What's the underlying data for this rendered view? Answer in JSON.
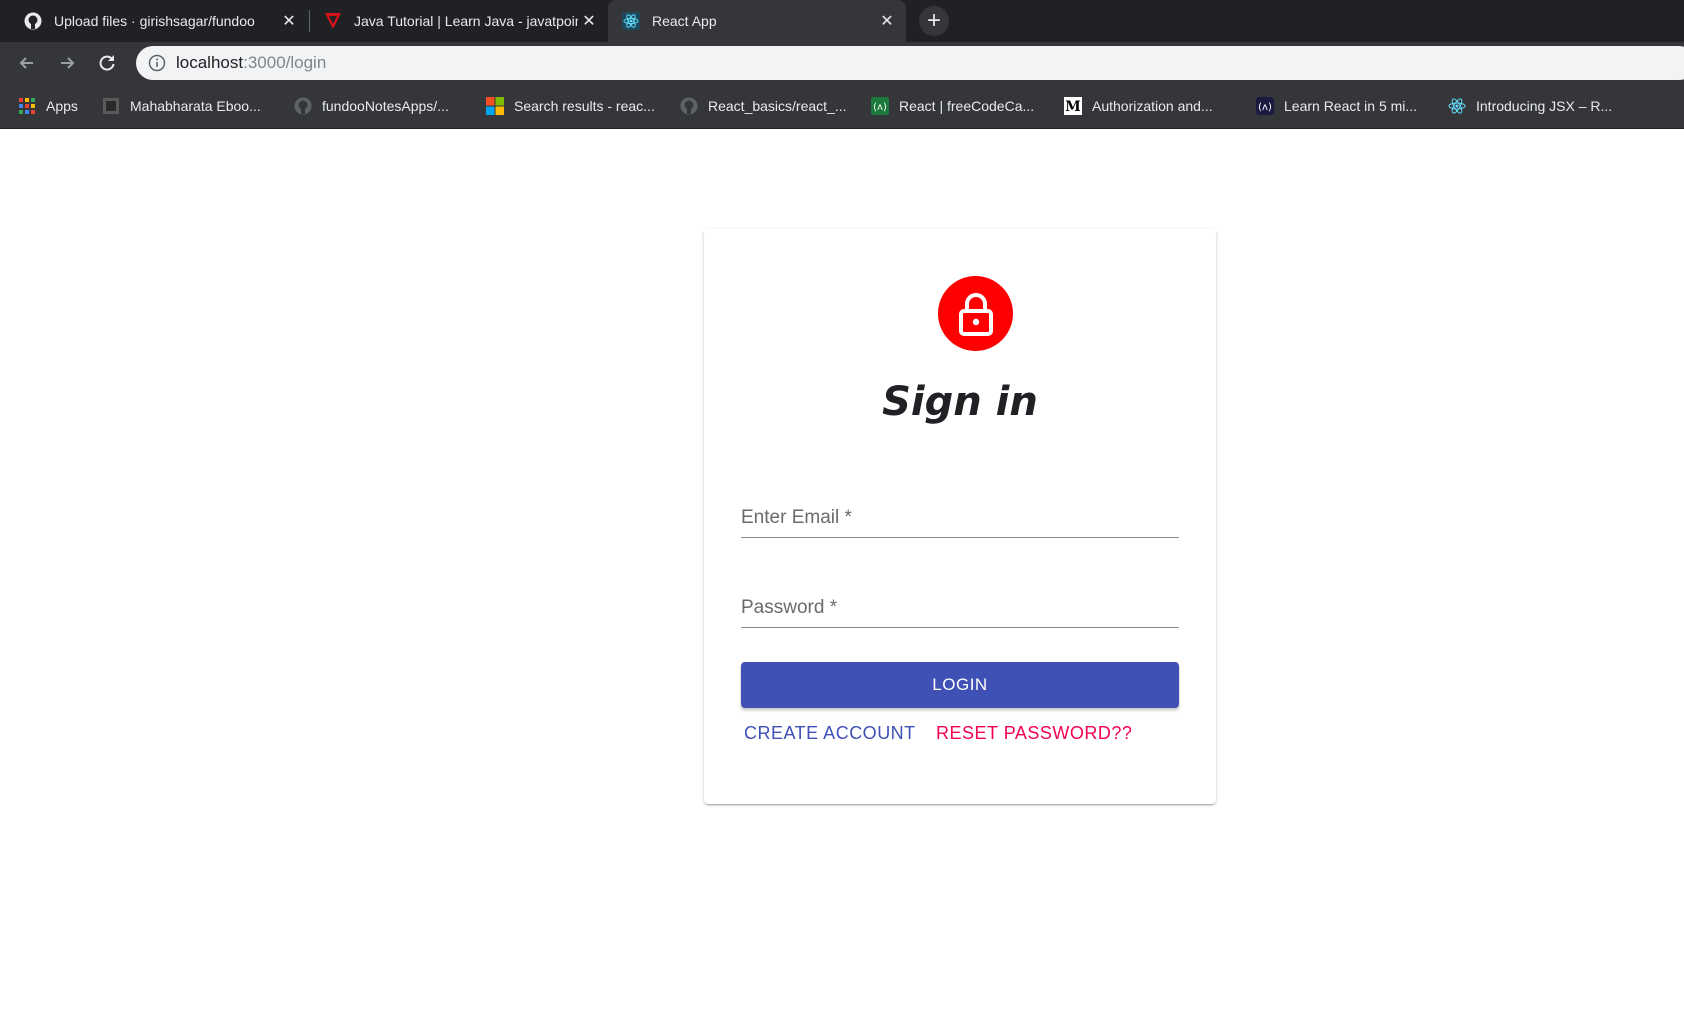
{
  "tabs": [
    {
      "title": "Upload files · girishsagar/fundoo",
      "icon": "github-icon",
      "active": false
    },
    {
      "title": "Java Tutorial | Learn Java - javatpoint",
      "icon": "javatpoint-icon",
      "active": false
    },
    {
      "title": "React App",
      "icon": "react-icon",
      "active": true
    }
  ],
  "address": {
    "host": "localhost",
    "path": ":3000/login"
  },
  "bookmarks": [
    {
      "label": "Apps",
      "icon": "apps-grid-icon"
    },
    {
      "label": "Mahabharata Eboo...",
      "icon": "book-icon"
    },
    {
      "label": "fundooNotesApps/...",
      "icon": "github-icon"
    },
    {
      "label": "Search results - reac...",
      "icon": "microsoft-icon"
    },
    {
      "label": "React_basics/react_...",
      "icon": "github-icon"
    },
    {
      "label": "React | freeCodeCa...",
      "icon": "freecodecamp-icon"
    },
    {
      "label": "Authorization and...",
      "icon": "medium-icon"
    },
    {
      "label": "Learn React in 5 mi...",
      "icon": "scrimba-icon"
    },
    {
      "label": "Introducing JSX – R...",
      "icon": "react-icon"
    }
  ],
  "form": {
    "title": "Sign in",
    "email_label": "Enter Email *",
    "password_label": "Password *",
    "login_label": "LOGIN",
    "create_label": "CREATE ACCOUNT",
    "reset_label": "RESET PASSWORD??"
  },
  "colors": {
    "primary": "#3f51b5",
    "secondary": "#f50057",
    "avatar": "#ff0000"
  }
}
